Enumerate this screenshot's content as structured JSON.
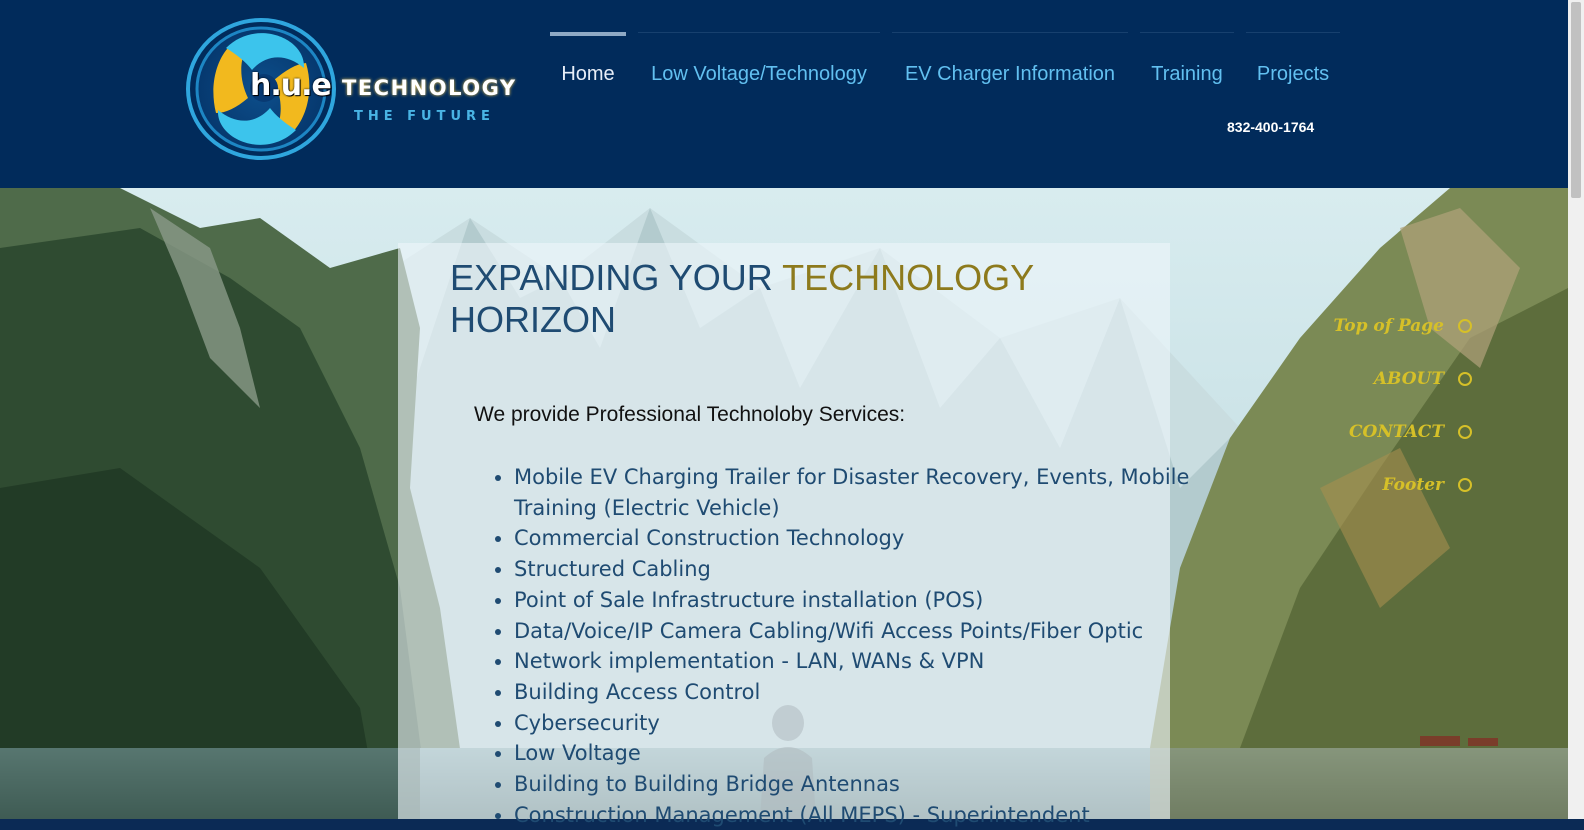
{
  "logo": {
    "hue": "h.u.e",
    "technology": "TECHNOLOGY",
    "tagline": "THE FUTURE"
  },
  "nav": {
    "items": [
      {
        "label": "Home",
        "active": true
      },
      {
        "label": "Low Voltage/Technology",
        "active": false
      },
      {
        "label": "EV Charger Information",
        "active": false
      },
      {
        "label": "Training",
        "active": false
      },
      {
        "label": "Projects",
        "active": false
      }
    ],
    "phone": "832-400-1764"
  },
  "main": {
    "headline_part1": "EXPANDING YOUR ",
    "headline_accent": "TECHNOLOGY",
    "headline_part2": "HORIZON",
    "intro": "We provide Professional Technoloby Services:",
    "services": [
      "Mobile EV Charging Trailer for Disaster Recovery, Events, Mobile Training (Electric Vehicle)",
      "Commercial Construction Technology",
      "Structured Cabling",
      "Point of Sale Infrastructure installation (POS)",
      "Data/Voice/IP Camera Cabling/Wifi Access Points/Fiber Optic",
      "Network implementation - LAN, WANs & VPN",
      "Building Access Control",
      "Cybersecurity",
      "Low Voltage",
      "Building to Building Bridge Antennas",
      "Construction Management (All MEPS) - Superintendent"
    ]
  },
  "anchors": [
    {
      "label": "Top of Page"
    },
    {
      "label": "ABOUT"
    },
    {
      "label": "CONTACT"
    },
    {
      "label": "Footer"
    }
  ],
  "colors": {
    "header_bg": "#012b5b",
    "nav_link": "#62c0f0",
    "headline": "#1f4b72",
    "accent": "#8d7a1c",
    "anchor": "#d6c028"
  }
}
